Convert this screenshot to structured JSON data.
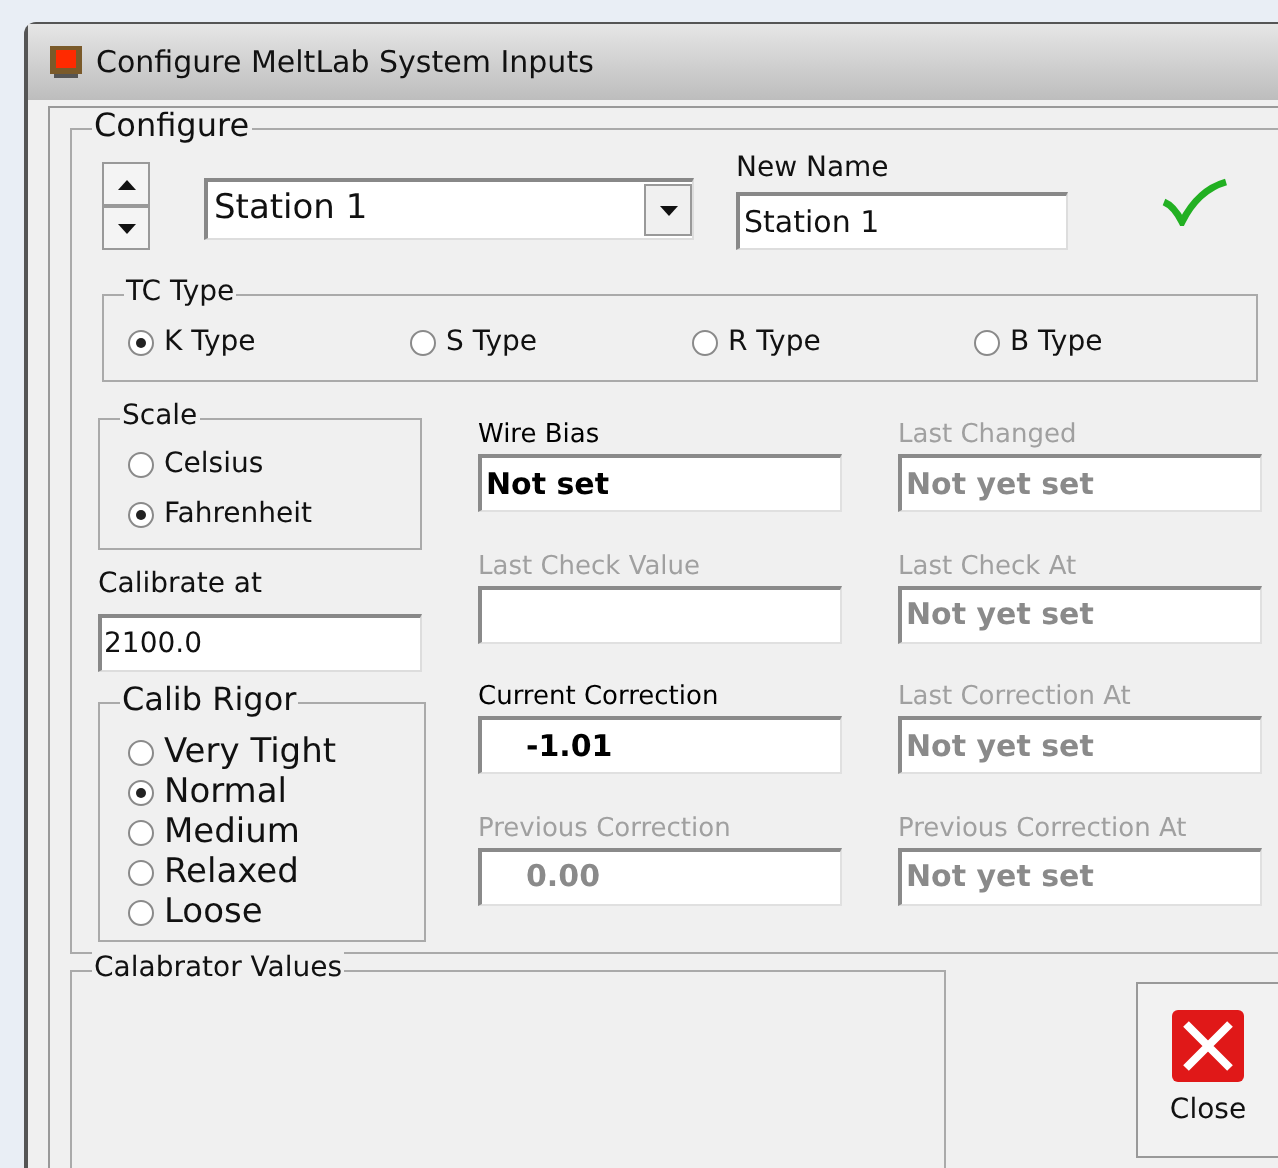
{
  "window": {
    "title": "Configure MeltLab System Inputs"
  },
  "configure": {
    "title": "Configure",
    "station": "Station 1",
    "new_name_label": "New Name",
    "new_name": "Station 1"
  },
  "tc_type": {
    "title": "TC Type",
    "options": [
      {
        "label": "K Type",
        "selected": true
      },
      {
        "label": "S Type",
        "selected": false
      },
      {
        "label": "R Type",
        "selected": false
      },
      {
        "label": "B Type",
        "selected": false
      }
    ]
  },
  "scale": {
    "title": "Scale",
    "options": [
      {
        "label": "Celsius",
        "selected": false
      },
      {
        "label": "Fahrenheit",
        "selected": true
      }
    ]
  },
  "calibrate_at": {
    "label": "Calibrate at",
    "value": "2100.0"
  },
  "calib_rigor": {
    "title": "Calib Rigor",
    "options": [
      {
        "label": "Very Tight",
        "selected": false
      },
      {
        "label": "Normal",
        "selected": true
      },
      {
        "label": "Medium",
        "selected": false
      },
      {
        "label": "Relaxed",
        "selected": false
      },
      {
        "label": "Loose",
        "selected": false
      }
    ]
  },
  "fields": [
    {
      "label": "Wire Bias",
      "value": "Not set",
      "disabled": false
    },
    {
      "label": "Last Changed",
      "value": "Not yet set",
      "disabled": true
    },
    {
      "label": "Last Check Value",
      "disabled": true
    },
    {
      "label": "Last Check At",
      "value": "Not yet set",
      "disabled": true
    },
    {
      "label": "Current Correction",
      "value": "-1.01",
      "disabled": false,
      "indent": true
    },
    {
      "label": "Last Correction At",
      "value": "Not yet set",
      "disabled": true
    },
    {
      "label": "Previous Correction",
      "value": "0.00",
      "disabled": true,
      "indent": true
    },
    {
      "label": "Previous Correction At",
      "value": "Not yet set",
      "disabled": true
    }
  ],
  "calibrator_values": {
    "title": "Calabrator Values"
  },
  "close_button": "Close"
}
